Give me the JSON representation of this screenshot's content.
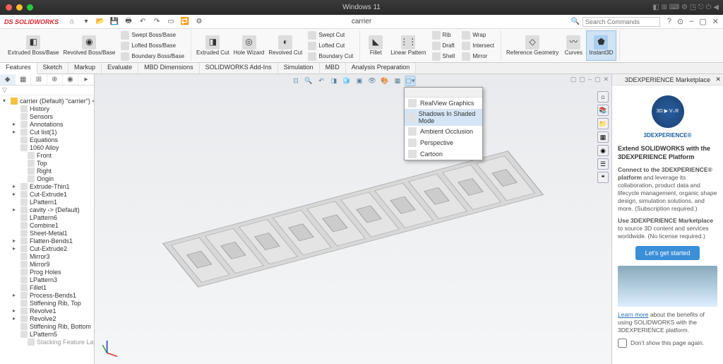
{
  "mac": {
    "title": "Windows 11"
  },
  "appbar": {
    "logo_prefix": "DS ",
    "logo": "SOLIDWORKS",
    "doc": "carrier",
    "search_placeholder": "Search Commands"
  },
  "ribbon": {
    "g1_big1": "Extruded\nBoss/Base",
    "g1_big2": "Revolved\nBoss/Base",
    "g1_s1": "Swept Boss/Base",
    "g1_s2": "Lofted Boss/Base",
    "g1_s3": "Boundary Boss/Base",
    "g2_big1": "Extruded\nCut",
    "g2_big2": "Hole\nWizard",
    "g2_big3": "Revolved\nCut",
    "g2_s1": "Swept Cut",
    "g2_s2": "Lofted Cut",
    "g2_s3": "Boundary Cut",
    "g3_big1": "Fillet",
    "g3_big2": "Linear\nPattern",
    "g3_s1": "Rib",
    "g3_s2": "Draft",
    "g3_s3": "Shell",
    "g3_s4": "Wrap",
    "g3_s5": "Intersect",
    "g3_s6": "Mirror",
    "g4_big1": "Reference\nGeometry",
    "g4_big2": "Curves",
    "g4_big3": "Instant3D"
  },
  "tabs": [
    "Features",
    "Sketch",
    "Markup",
    "Evaluate",
    "MBD Dimensions",
    "SOLIDWORKS Add-Ins",
    "Simulation",
    "MBD",
    "Analysis Preparation"
  ],
  "tree": {
    "root": "carrier (Default) \"carrier\") <<Default>",
    "items": [
      {
        "l": 1,
        "t": "History"
      },
      {
        "l": 1,
        "t": "Sensors"
      },
      {
        "l": 1,
        "t": "Annotations",
        "exp": "▸"
      },
      {
        "l": 1,
        "t": "Cut list(1)",
        "exp": "▸"
      },
      {
        "l": 1,
        "t": "Equations"
      },
      {
        "l": 1,
        "t": "1060 Alloy"
      },
      {
        "l": 2,
        "t": "Front"
      },
      {
        "l": 2,
        "t": "Top"
      },
      {
        "l": 2,
        "t": "Right"
      },
      {
        "l": 2,
        "t": "Origin"
      },
      {
        "l": 1,
        "t": "Extrude-Thin1",
        "exp": "▸"
      },
      {
        "l": 1,
        "t": "Cut-Extrude1",
        "exp": "▸"
      },
      {
        "l": 1,
        "t": "LPattern1"
      },
      {
        "l": 1,
        "t": "cavity -> (Default)",
        "exp": "▸"
      },
      {
        "l": 1,
        "t": "LPattern6"
      },
      {
        "l": 1,
        "t": "Combine1"
      },
      {
        "l": 1,
        "t": "Sheet-Metal1"
      },
      {
        "l": 1,
        "t": "Flatten-Bends1",
        "exp": "▸"
      },
      {
        "l": 1,
        "t": "Cut-Extrude2",
        "exp": "▸"
      },
      {
        "l": 1,
        "t": "Mirror3"
      },
      {
        "l": 1,
        "t": "Mirror9"
      },
      {
        "l": 1,
        "t": "Prog Holes"
      },
      {
        "l": 1,
        "t": "LPattern3"
      },
      {
        "l": 1,
        "t": "Fillet1"
      },
      {
        "l": 1,
        "t": "Process-Bends1",
        "exp": "▸"
      },
      {
        "l": 1,
        "t": "Stiffening Rib, Top"
      },
      {
        "l": 1,
        "t": "Revolve1",
        "exp": "▸"
      },
      {
        "l": 1,
        "t": "Revolve2",
        "exp": "▸"
      },
      {
        "l": 1,
        "t": "Stiffening Rib, Bottom"
      },
      {
        "l": 1,
        "t": "LPattern5"
      },
      {
        "l": 2,
        "t": "Stacking Feature Layout",
        "hidden": true
      }
    ]
  },
  "popup": {
    "items": [
      "RealView Graphics",
      "Shadows In Shaded Mode",
      "Ambient Occlusion",
      "Perspective",
      "Cartoon"
    ]
  },
  "rp": {
    "title": "3DEXPERIENCE Marketplace",
    "brand": "3DEXPERIENCE®",
    "h1": "Extend SOLIDWORKS with the 3DEXPERIENCE Platform",
    "p1a": "Connect to the 3DEXPERIENCE® platform",
    "p1b": " and leverage its collaboration, product data and lifecycle management, organic shape design, simulation solutions, and more. (Subscription required.)",
    "p2a": "Use 3DEXPERIENCE Marketplace",
    "p2b": " to source 3D content and services worldwide. (No license required.)",
    "btn": "Let's get started",
    "link": "Learn more",
    "p3": " about the benefits of using SOLIDWORKS with the 3DEXPERIENCE platform.",
    "check": "Don't show this page again."
  }
}
